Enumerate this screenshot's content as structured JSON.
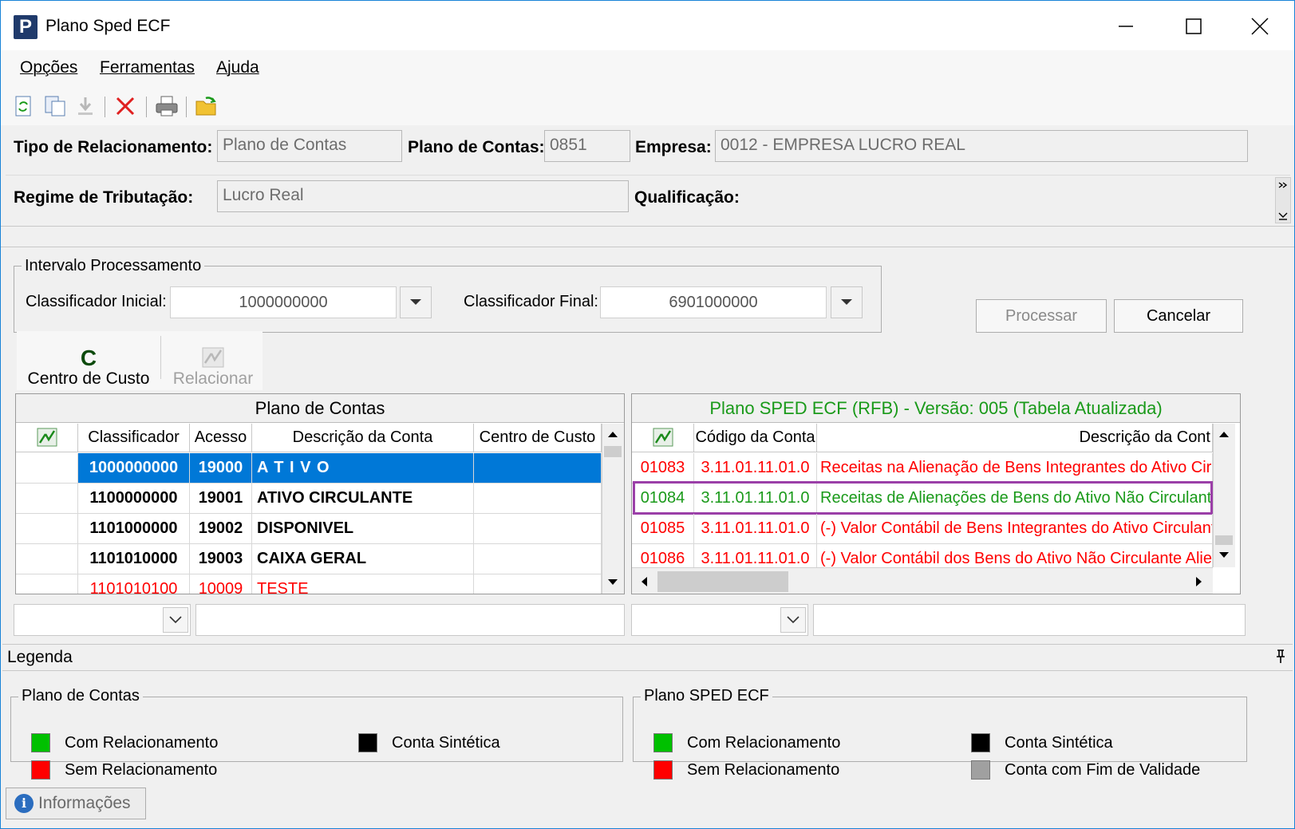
{
  "window": {
    "title": "Plano Sped ECF",
    "app_icon_letter": "P"
  },
  "menu": {
    "items": [
      "Opções",
      "Ferramentas",
      "Ajuda"
    ]
  },
  "toolbar": {
    "icons": [
      "refresh-doc-icon",
      "copy-icon",
      "download-icon",
      "delete-icon",
      "print-icon",
      "open-folder-icon"
    ]
  },
  "header": {
    "tipo_label": "Tipo de Relacionamento:",
    "tipo_value": "Plano de Contas",
    "plano_label": "Plano de Contas:",
    "plano_value": "0851",
    "empresa_label": "Empresa:",
    "empresa_value": "0012 - EMPRESA LUCRO REAL",
    "regime_label": "Regime de Tributação:",
    "regime_value": "Lucro Real",
    "qualificacao_label": "Qualificação:"
  },
  "intervalo": {
    "title": "Intervalo Processamento",
    "inicial_label": "Classificador Inicial:",
    "inicial_value": "1000000000",
    "final_label": "Classificador Final:",
    "final_value": "6901000000"
  },
  "buttons": {
    "processar": "Processar",
    "cancelar": "Cancelar",
    "centro_custo": "Centro de Custo",
    "centro_custo_icon_letter": "C",
    "relacionar": "Relacionar"
  },
  "left_grid": {
    "caption": "Plano de Contas",
    "columns": [
      "Classificador",
      "Acesso",
      "Descrição da Conta",
      "Centro de Custo"
    ],
    "rows": [
      {
        "classificador": "1000000000",
        "acesso": "19000",
        "descricao": "A T I V O",
        "centro": "",
        "style": "selected"
      },
      {
        "classificador": "1100000000",
        "acesso": "19001",
        "descricao": "ATIVO CIRCULANTE",
        "centro": "",
        "style": "bold"
      },
      {
        "classificador": "1101000000",
        "acesso": "19002",
        "descricao": "DISPONIVEL",
        "centro": "",
        "style": "bold"
      },
      {
        "classificador": "1101010000",
        "acesso": "19003",
        "descricao": "CAIXA GERAL",
        "centro": "",
        "style": "bold"
      },
      {
        "classificador": "1101010100",
        "acesso": "10009",
        "descricao": "TESTE",
        "centro": "",
        "style": "red"
      }
    ]
  },
  "right_grid": {
    "caption": "Plano SPED ECF (RFB) - Versão: 005 (Tabela Atualizada)",
    "columns": [
      "Código da Conta",
      "Descrição da Cont"
    ],
    "rows": [
      {
        "id": "01083",
        "codigo": "3.11.01.11.01.0",
        "descricao": "Receitas na Alienação de Bens Integrantes do Ativo Circu",
        "style": "red"
      },
      {
        "id": "01084",
        "codigo": "3.11.01.11.01.0",
        "descricao": "Receitas de Alienações de Bens do Ativo Não Circulante",
        "style": "green"
      },
      {
        "id": "01085",
        "codigo": "3.11.01.11.01.0",
        "descricao": "(-) Valor Contábil de Bens Integrantes do Ativo Circulante",
        "style": "red"
      },
      {
        "id": "01086",
        "codigo": "3.11.01.11.01.0",
        "descricao": "(-) Valor Contábil dos Bens do Ativo Não Circulante Aliena",
        "style": "red"
      }
    ]
  },
  "legend": {
    "title": "Legenda",
    "left_title": "Plano de Contas",
    "left_items": [
      "Com Relacionamento",
      "Sem Relacionamento",
      "Conta Sintética"
    ],
    "right_title": "Plano SPED ECF",
    "right_items": [
      "Com Relacionamento",
      "Sem Relacionamento",
      "Conta Sintética",
      "Conta com Fim de Validade"
    ],
    "colors": {
      "green": "#00c000",
      "red": "#ff0000",
      "black": "#000000",
      "gray": "#a0a0a0"
    }
  },
  "status": {
    "info_label": "Informações"
  },
  "colors": {
    "selected_row": "#0078d7",
    "red_text": "#ff0000",
    "green_text": "#1a9a1a",
    "highlight_border": "#9b3fa8"
  }
}
